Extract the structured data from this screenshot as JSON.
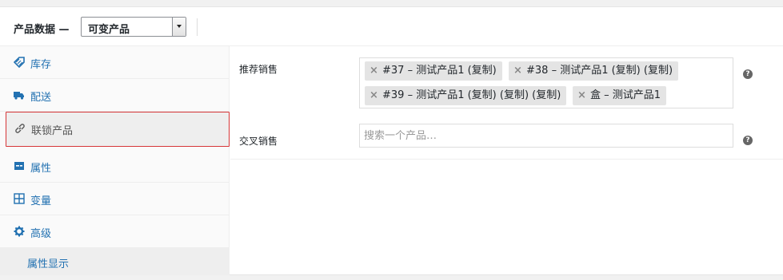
{
  "header": {
    "title": "产品数据 —",
    "product_type": "可变产品"
  },
  "sidebar": {
    "tabs": [
      {
        "label": "库存",
        "icon": "inventory-tag-icon",
        "active": false
      },
      {
        "label": "配送",
        "icon": "truck-icon",
        "active": false
      },
      {
        "label": "联锁产品",
        "icon": "link-icon",
        "active": true
      },
      {
        "label": "属性",
        "icon": "attributes-icon",
        "active": false
      },
      {
        "label": "变量",
        "icon": "grid-icon",
        "active": false
      },
      {
        "label": "高级",
        "icon": "gear-icon",
        "active": false
      }
    ],
    "subtab": {
      "label": "属性显示"
    }
  },
  "linked_products": {
    "upsells": {
      "label": "推荐销售",
      "items": [
        "#37 – 测试产品1 (复制)",
        "#38 – 测试产品1 (复制) (复制)",
        "#39 – 测试产品1 (复制) (复制) (复制)",
        "盒 – 测试产品1"
      ],
      "help": "?"
    },
    "crosssells": {
      "label": "交叉销售",
      "placeholder": "搜索一个产品…",
      "help": "?"
    }
  }
}
